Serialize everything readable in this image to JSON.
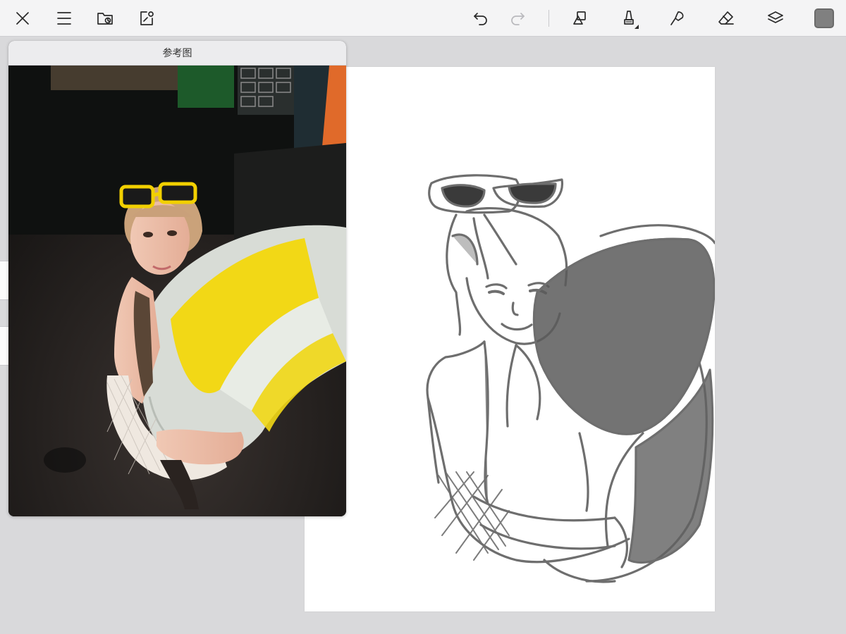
{
  "toolbar": {
    "left_icons": [
      "close-icon",
      "menu-icon",
      "folder-icon",
      "export-icon"
    ],
    "right_icons": [
      "undo-icon",
      "redo-icon",
      "shapes-icon",
      "brush-icon",
      "smudge-icon",
      "eraser-icon",
      "layers-icon"
    ],
    "redo_enabled": false,
    "current_color": "#808080"
  },
  "reference_panel": {
    "title": "参考图"
  },
  "colors": {
    "background": "#d9d9db",
    "toolbar": "#f4f4f5",
    "sketch_stroke": "#6e6e6e",
    "ring_yellow": "#f2d816",
    "ring_white": "#d8dcd6"
  }
}
